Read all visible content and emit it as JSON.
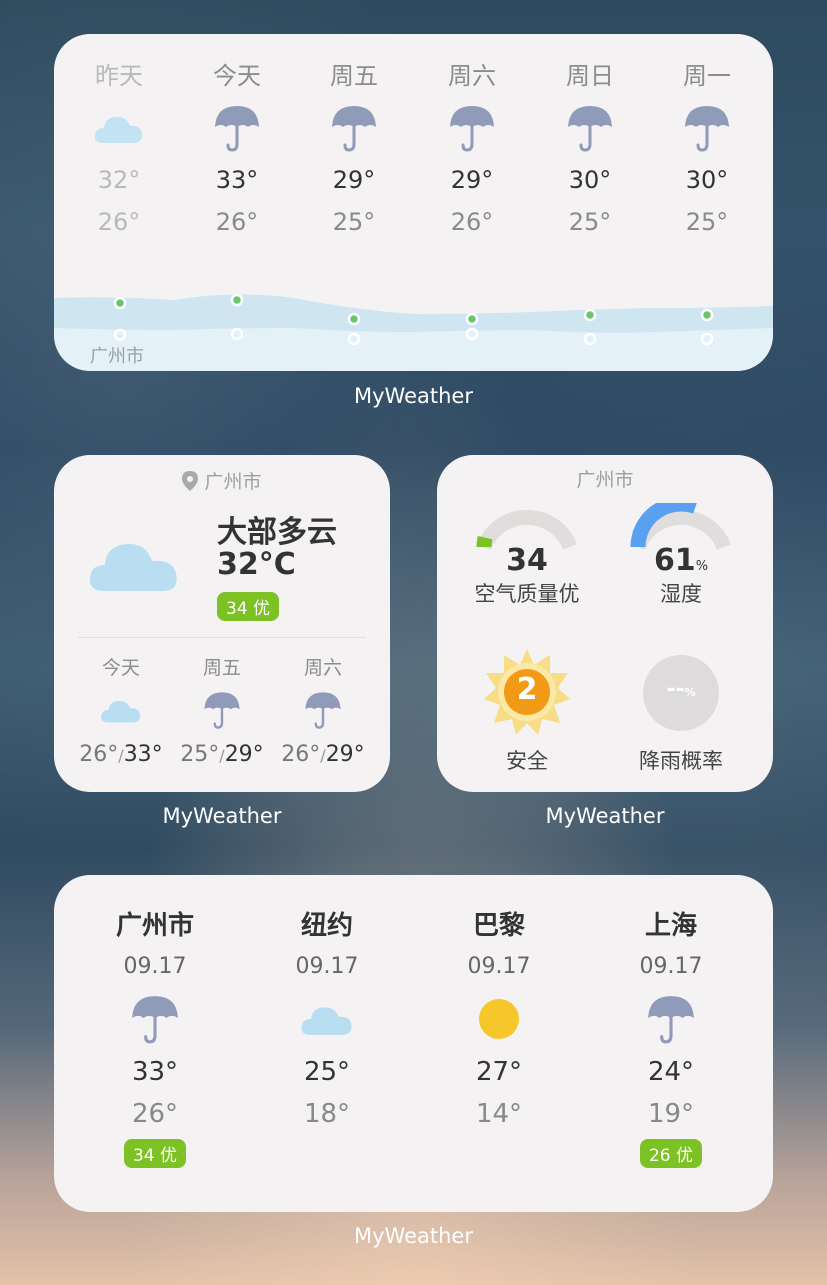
{
  "forecast_widget": {
    "city": "广州市",
    "days": [
      {
        "day": "昨天",
        "icon": "cloud-icon",
        "high": "32°",
        "low": "26°",
        "past": true
      },
      {
        "day": "今天",
        "icon": "umbrella-icon",
        "high": "33°",
        "low": "26°"
      },
      {
        "day": "周五",
        "icon": "umbrella-icon",
        "high": "29°",
        "low": "25°"
      },
      {
        "day": "周六",
        "icon": "umbrella-icon",
        "high": "29°",
        "low": "26°"
      },
      {
        "day": "周日",
        "icon": "umbrella-icon",
        "high": "30°",
        "low": "25°"
      },
      {
        "day": "周一",
        "icon": "umbrella-icon",
        "high": "30°",
        "low": "25°"
      }
    ],
    "caption": "MyWeather"
  },
  "current_widget": {
    "city": "广州市",
    "condition": "大部多云",
    "temperature": "32°C",
    "aqi_badge": "34 优",
    "days": [
      {
        "day": "今天",
        "icon": "cloud-icon",
        "low": "26°",
        "high": "33°"
      },
      {
        "day": "周五",
        "icon": "umbrella-icon",
        "low": "25°",
        "high": "29°"
      },
      {
        "day": "周六",
        "icon": "umbrella-icon",
        "low": "26°",
        "high": "29°"
      }
    ],
    "separator": "/",
    "caption": "MyWeather"
  },
  "details_widget": {
    "city": "广州市",
    "aqi": {
      "value": "34",
      "label": "空气质量优",
      "fraction": 0.07,
      "color": "#7cc225"
    },
    "humidity": {
      "value": "61",
      "unit": "%",
      "label": "湿度",
      "fraction": 0.61,
      "color": "#5aa0f0"
    },
    "uv": {
      "value": "2",
      "label": "安全",
      "color": "#f29a16"
    },
    "rain": {
      "value": "--",
      "unit": "%",
      "label": "降雨概率"
    },
    "caption": "MyWeather"
  },
  "cities_widget": {
    "cities": [
      {
        "name": "广州市",
        "date": "09.17",
        "icon": "umbrella-icon",
        "high": "33°",
        "low": "26°",
        "badge": "34 优"
      },
      {
        "name": "纽约",
        "date": "09.17",
        "icon": "cloud-icon",
        "high": "25°",
        "low": "18°",
        "badge": ""
      },
      {
        "name": "巴黎",
        "date": "09.17",
        "icon": "sun-icon",
        "high": "27°",
        "low": "14°",
        "badge": ""
      },
      {
        "name": "上海",
        "date": "09.17",
        "icon": "umbrella-icon",
        "high": "24°",
        "low": "19°",
        "badge": "26 优"
      }
    ],
    "caption": "MyWeather"
  },
  "colors": {
    "card": "#f5f2f3",
    "badge": "#7cc225",
    "umbrella": "#8f9bb8",
    "cloud": "#b9def2",
    "sun": "#f7c62a"
  }
}
